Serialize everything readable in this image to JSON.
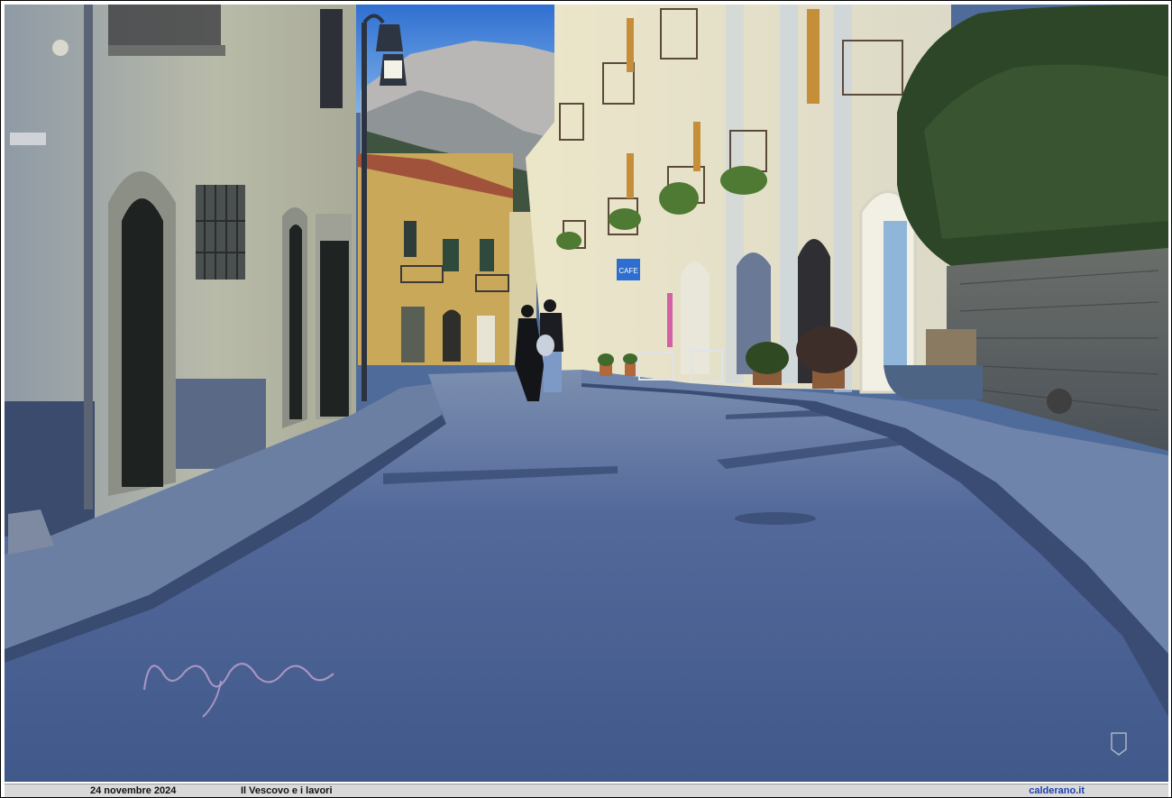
{
  "caption": {
    "date": "24 novembre 2024",
    "title": "Il Vescovo e i lavori",
    "site": "calderano.it"
  },
  "photo": {
    "shop_sign": "CAFE",
    "colors": {
      "sky": "#3f7fd6",
      "road": "#4f6894",
      "sidewalk": "#6a82a8",
      "left_building": "#aab0a4",
      "yellow_building": "#c8a95a",
      "right_building": "#e6e2cc",
      "stone_wall": "#545a5c",
      "foliage": "#2f4a2a",
      "mountain": "#b9b8b5"
    }
  }
}
